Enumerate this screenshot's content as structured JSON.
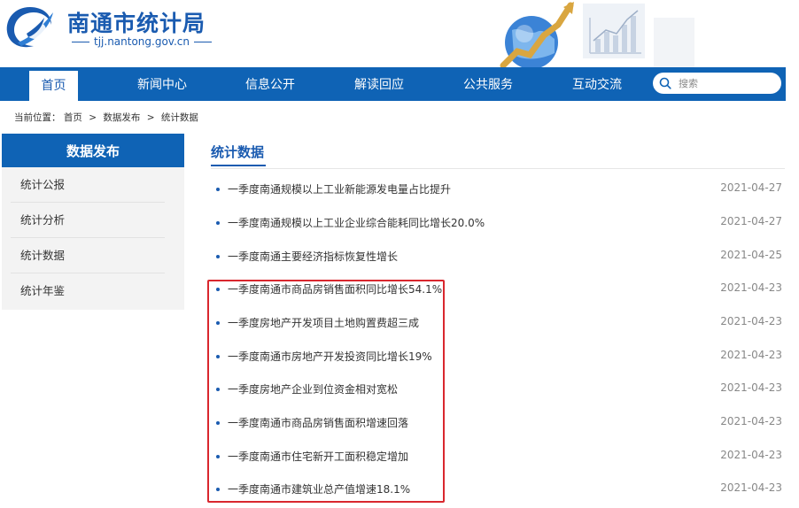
{
  "header": {
    "site_name": "南通市统计局",
    "domain": "tjj.nantong.gov.cn",
    "brand_color": "#1a5bb0"
  },
  "nav": {
    "items": [
      {
        "label": "首页",
        "active": true
      },
      {
        "label": "新闻中心"
      },
      {
        "label": "信息公开"
      },
      {
        "label": "解读回应"
      },
      {
        "label": "公共服务"
      },
      {
        "label": "互动交流"
      }
    ],
    "search_placeholder": "搜索",
    "bar_color": "#0f63b5"
  },
  "breadcrumb": {
    "prefix": "当前位置：",
    "items": [
      "首页",
      "数据发布",
      "统计数据"
    ],
    "separator": ">"
  },
  "sidebar": {
    "title": "数据发布",
    "items": [
      "统计公报",
      "统计分析",
      "统计数据",
      "统计年鉴"
    ]
  },
  "main": {
    "section_title": "统计数据",
    "articles": [
      {
        "title": "一季度南通规模以上工业新能源发电量占比提升",
        "date": "2021-04-27"
      },
      {
        "title": "一季度南通规模以上工业企业综合能耗同比增长20.0%",
        "date": "2021-04-27"
      },
      {
        "title": "一季度南通主要经济指标恢复性增长",
        "date": "2021-04-25"
      },
      {
        "title": "一季度南通市商品房销售面积同比增长54.1%",
        "date": "2021-04-23"
      },
      {
        "title": "一季度房地产开发项目土地购置费超三成",
        "date": "2021-04-23"
      },
      {
        "title": "一季度南通市房地产开发投资同比增长19%",
        "date": "2021-04-23"
      },
      {
        "title": "一季度房地产企业到位资金相对宽松",
        "date": "2021-04-23"
      },
      {
        "title": "一季度南通市商品房销售面积增速回落",
        "date": "2021-04-23"
      },
      {
        "title": "一季度南通市住宅新开工面积稳定增加",
        "date": "2021-04-23"
      },
      {
        "title": "一季度南通市建筑业总产值增速18.1%",
        "date": "2021-04-23"
      }
    ],
    "highlight_color": "#d9272e"
  }
}
